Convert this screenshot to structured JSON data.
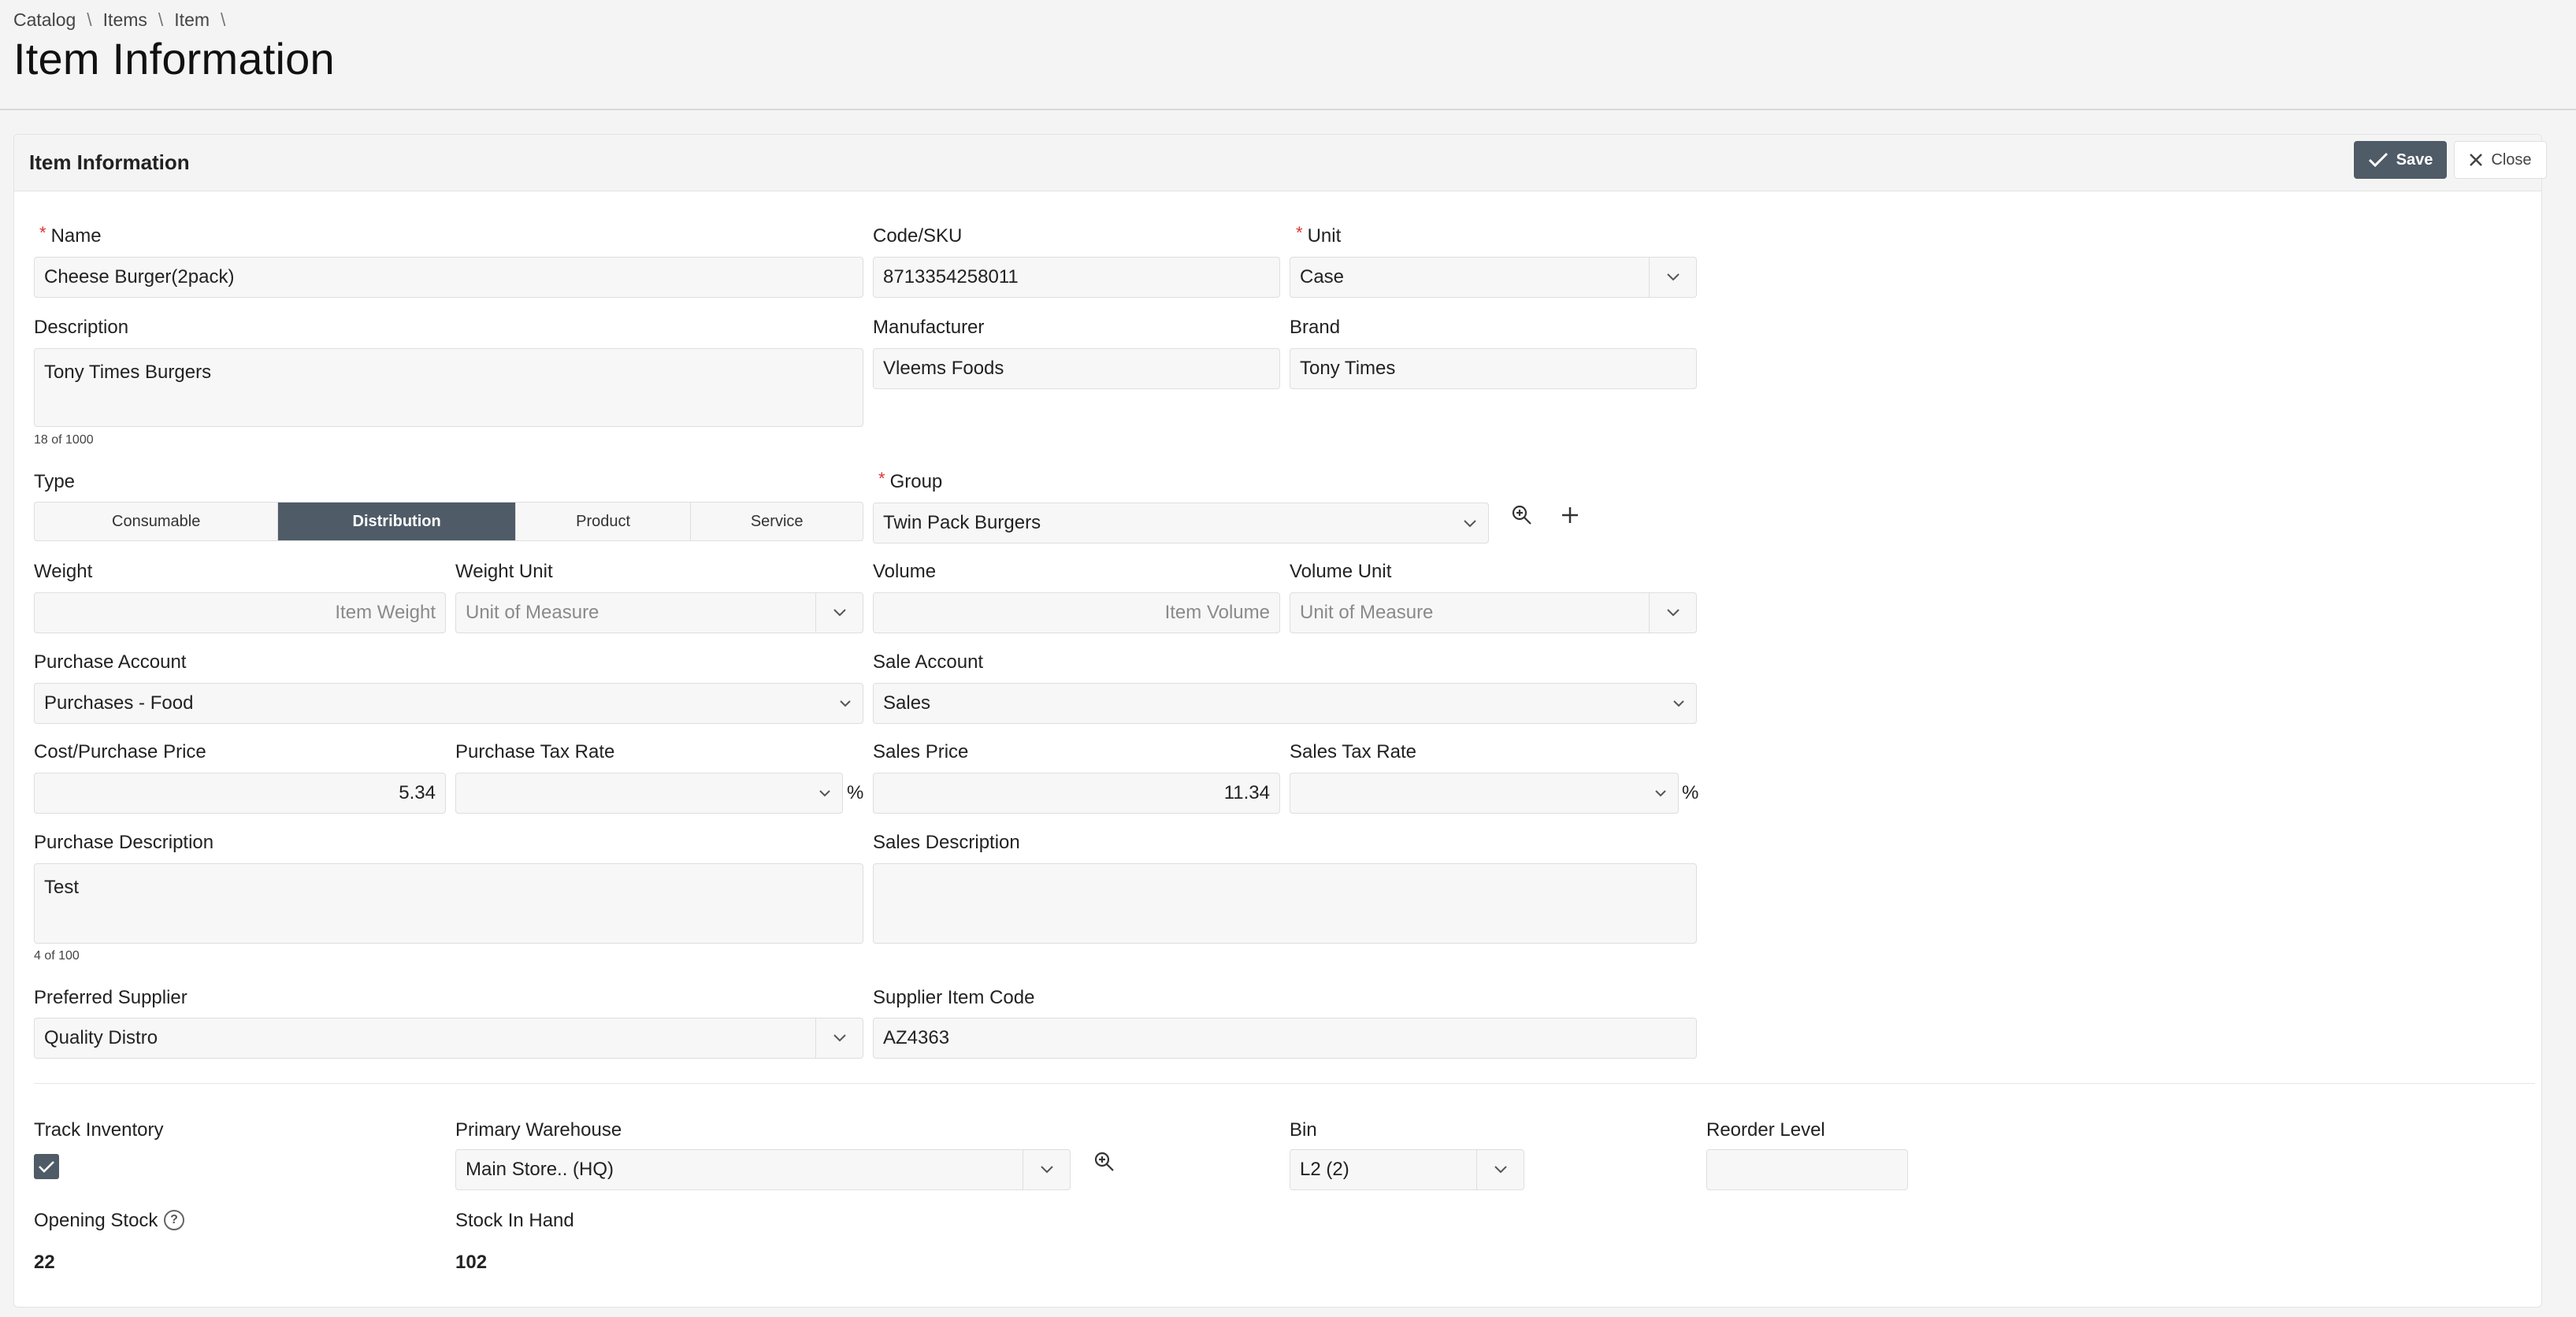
{
  "breadcrumb": [
    "Catalog",
    "Items",
    "Item"
  ],
  "breadcrumb_sep": "\\",
  "page_title": "Item Information",
  "panel": {
    "title": "Item Information",
    "save_label": "Save",
    "close_label": "Close"
  },
  "form": {
    "name": {
      "label": "Name",
      "value": "Cheese Burger(2pack)"
    },
    "code": {
      "label": "Code/SKU",
      "value": "8713354258011"
    },
    "unit": {
      "label": "Unit",
      "value": "Case"
    },
    "description": {
      "label": "Description",
      "value": "Tony Times Burgers",
      "counter": "18 of 1000"
    },
    "manufacturer": {
      "label": "Manufacturer",
      "value": "Vleems Foods"
    },
    "brand": {
      "label": "Brand",
      "value": "Tony Times"
    },
    "type": {
      "label": "Type",
      "options": [
        "Consumable",
        "Distribution",
        "Product",
        "Service"
      ],
      "selected": "Distribution"
    },
    "group": {
      "label": "Group",
      "value": "Twin Pack Burgers"
    },
    "weight": {
      "label": "Weight",
      "placeholder": "Item Weight"
    },
    "weight_unit": {
      "label": "Weight Unit",
      "placeholder": "Unit of Measure"
    },
    "volume": {
      "label": "Volume",
      "placeholder": "Item Volume"
    },
    "volume_unit": {
      "label": "Volume Unit",
      "placeholder": "Unit of Measure"
    },
    "purchase_account": {
      "label": "Purchase Account",
      "value": "Purchases - Food"
    },
    "sale_account": {
      "label": "Sale Account",
      "value": "Sales"
    },
    "cost_price": {
      "label": "Cost/Purchase Price",
      "value": "5.34"
    },
    "purchase_tax": {
      "label": "Purchase Tax Rate",
      "value": "",
      "suffix": "%"
    },
    "sales_price": {
      "label": "Sales Price",
      "value": "11.34"
    },
    "sales_tax": {
      "label": "Sales Tax Rate",
      "value": "",
      "suffix": "%"
    },
    "purchase_description": {
      "label": "Purchase Description",
      "value": "Test",
      "counter": "4 of 100"
    },
    "sales_description": {
      "label": "Sales Description",
      "value": ""
    },
    "preferred_supplier": {
      "label": "Preferred Supplier",
      "value": "Quality Distro"
    },
    "supplier_item_code": {
      "label": "Supplier Item Code",
      "value": "AZ4363"
    },
    "track_inventory": {
      "label": "Track Inventory",
      "checked": true
    },
    "primary_warehouse": {
      "label": "Primary Warehouse",
      "value": "Main Store.. (HQ)"
    },
    "bin": {
      "label": "Bin",
      "value": "L2 (2)"
    },
    "reorder_level": {
      "label": "Reorder Level",
      "value": ""
    },
    "opening_stock": {
      "label": "Opening Stock",
      "value": "22"
    },
    "stock_in_hand": {
      "label": "Stock In Hand",
      "value": "102"
    }
  },
  "colors": {
    "accent": "#4f5b67",
    "required": "#dd3333",
    "field_bg": "#f7f7f7"
  }
}
